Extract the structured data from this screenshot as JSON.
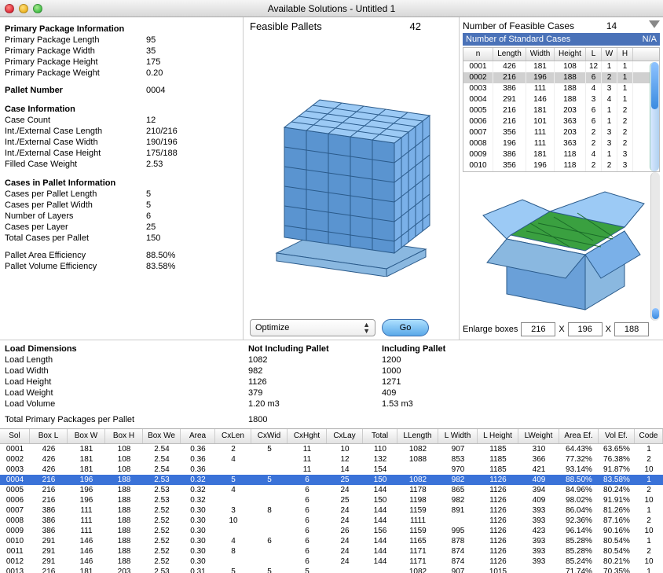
{
  "window": {
    "title": "Available Solutions - Untitled 1"
  },
  "left": {
    "sec1": "Primary Package Information",
    "ppl_l": "Primary Package Length",
    "ppl_v": "95",
    "ppw_l": "Primary Package Width",
    "ppw_v": "35",
    "pph_l": "Primary Package Height",
    "pph_v": "175",
    "ppwe_l": "Primary Package Weight",
    "ppwe_v": "0.20",
    "pn_l": "Pallet Number",
    "pn_v": "0004",
    "sec2": "Case Information",
    "cc_l": "Case Count",
    "cc_v": "12",
    "icl_l": "Int./External Case Length",
    "icl_v": "210/216",
    "icw_l": "Int./External Case Width",
    "icw_v": "190/196",
    "ich_l": "Int./External Case Height",
    "ich_v": "175/188",
    "fcw_l": "Filled Case Weight",
    "fcw_v": "2.53",
    "sec3": "Cases in Pallet Information",
    "cpl_l": "Cases per Pallet Length",
    "cpl_v": "5",
    "cpw_l": "Cases per Pallet Width",
    "cpw_v": "5",
    "nl_l": "Number of Layers",
    "nl_v": "6",
    "cply_l": "Cases per Layer",
    "cply_v": "25",
    "tcp_l": "Total Cases per Pallet",
    "tcp_v": "150",
    "pae_l": "Pallet Area Efficiency",
    "pae_v": "88.50%",
    "pve_l": "Pallet Volume Efficiency",
    "pve_v": "83.58%"
  },
  "center": {
    "fp_label": "Feasible Pallets",
    "fp_val": "42",
    "optimize": "Optimize",
    "go": "Go"
  },
  "right": {
    "nf_label": "Number of Feasible Cases",
    "nf_val": "14",
    "ns_label": "Number of Standard Cases",
    "ns_val": "N/A",
    "hdr": {
      "n": "n",
      "len": "Length",
      "wid": "Width",
      "hgt": "Height",
      "L": "L",
      "W": "W",
      "H": "H"
    },
    "rows": [
      {
        "n": "0001",
        "len": "426",
        "wid": "181",
        "hgt": "108",
        "L": "12",
        "W": "1",
        "H": "1"
      },
      {
        "n": "0002",
        "len": "216",
        "wid": "196",
        "hgt": "188",
        "L": "6",
        "W": "2",
        "H": "1",
        "sel": true
      },
      {
        "n": "0003",
        "len": "386",
        "wid": "111",
        "hgt": "188",
        "L": "4",
        "W": "3",
        "H": "1"
      },
      {
        "n": "0004",
        "len": "291",
        "wid": "146",
        "hgt": "188",
        "L": "3",
        "W": "4",
        "H": "1"
      },
      {
        "n": "0005",
        "len": "216",
        "wid": "181",
        "hgt": "203",
        "L": "6",
        "W": "1",
        "H": "2"
      },
      {
        "n": "0006",
        "len": "216",
        "wid": "101",
        "hgt": "363",
        "L": "6",
        "W": "1",
        "H": "2"
      },
      {
        "n": "0007",
        "len": "356",
        "wid": "111",
        "hgt": "203",
        "L": "2",
        "W": "3",
        "H": "2"
      },
      {
        "n": "0008",
        "len": "196",
        "wid": "111",
        "hgt": "363",
        "L": "2",
        "W": "3",
        "H": "2"
      },
      {
        "n": "0009",
        "len": "386",
        "wid": "181",
        "hgt": "118",
        "L": "4",
        "W": "1",
        "H": "3"
      },
      {
        "n": "0010",
        "len": "356",
        "wid": "196",
        "hgt": "118",
        "L": "2",
        "W": "2",
        "H": "3"
      }
    ],
    "enlarge_l": "Enlarge boxes",
    "e1": "216",
    "eX1": "X",
    "e2": "196",
    "eX2": "X",
    "e3": "188"
  },
  "load": {
    "hd": "Load Dimensions",
    "nip": "Not Including Pallet",
    "ip": "Including Pallet",
    "rows": [
      {
        "l": "Load Length",
        "a": "1082",
        "b": "1200"
      },
      {
        "l": "Load Width",
        "a": "982",
        "b": "1000"
      },
      {
        "l": "Load Height",
        "a": "1126",
        "b": "1271"
      },
      {
        "l": "Load Weight",
        "a": "379",
        "b": "409"
      },
      {
        "l": "Load Volume",
        "a": "1.20 m3",
        "b": "1.53 m3"
      }
    ],
    "tpp_l": "Total Primary Packages per Pallet",
    "tpp_v": "1800"
  },
  "table": {
    "hdr": {
      "sol": "Sol",
      "bl": "Box L",
      "bw": "Box W",
      "bh": "Box H",
      "bwe": "Box We",
      "ar": "Area",
      "cl": "CxLen",
      "cw": "CxWid",
      "ch": "CxHght",
      "cx": "CxLay",
      "tot": "Total",
      "ll": "LLength",
      "lw": "L Width",
      "lh": "L Height",
      "lwe": "LWeight",
      "ae": "Area Ef.",
      "ve": "Vol Ef.",
      "cd": "Code"
    },
    "rows": [
      {
        "sol": "0001",
        "bl": "426",
        "bw": "181",
        "bh": "108",
        "bwe": "2.54",
        "ar": "0.36",
        "cl": "2",
        "cw": "5",
        "ch": "11",
        "cx": "10",
        "tot": "110",
        "ll": "1082",
        "lw": "907",
        "lh": "1185",
        "lwe": "310",
        "ae": "64.43%",
        "ve": "63.65%",
        "cd": "1"
      },
      {
        "sol": "0002",
        "bl": "426",
        "bw": "181",
        "bh": "108",
        "bwe": "2.54",
        "ar": "0.36",
        "cl": "4",
        "cw": "",
        "ch": "11",
        "cx": "12",
        "tot": "132",
        "ll": "1088",
        "lw": "853",
        "lh": "1185",
        "lwe": "366",
        "ae": "77.32%",
        "ve": "76.38%",
        "cd": "2"
      },
      {
        "sol": "0003",
        "bl": "426",
        "bw": "181",
        "bh": "108",
        "bwe": "2.54",
        "ar": "0.36",
        "cl": "",
        "cw": "",
        "ch": "11",
        "cx": "14",
        "tot": "154",
        "ll": "",
        "lw": "970",
        "lh": "1185",
        "lwe": "421",
        "ae": "93.14%",
        "ve": "91.87%",
        "cd": "10"
      },
      {
        "sol": "0004",
        "bl": "216",
        "bw": "196",
        "bh": "188",
        "bwe": "2.53",
        "ar": "0.32",
        "cl": "5",
        "cw": "5",
        "ch": "6",
        "cx": "25",
        "tot": "150",
        "ll": "1082",
        "lw": "982",
        "lh": "1126",
        "lwe": "409",
        "ae": "88.50%",
        "ve": "83.58%",
        "cd": "1",
        "sel": true
      },
      {
        "sol": "0005",
        "bl": "216",
        "bw": "196",
        "bh": "188",
        "bwe": "2.53",
        "ar": "0.32",
        "cl": "4",
        "cw": "",
        "ch": "6",
        "cx": "24",
        "tot": "144",
        "ll": "1178",
        "lw": "865",
        "lh": "1126",
        "lwe": "394",
        "ae": "84.96%",
        "ve": "80.24%",
        "cd": "2"
      },
      {
        "sol": "0006",
        "bl": "216",
        "bw": "196",
        "bh": "188",
        "bwe": "2.53",
        "ar": "0.32",
        "cl": "",
        "cw": "",
        "ch": "6",
        "cx": "25",
        "tot": "150",
        "ll": "1198",
        "lw": "982",
        "lh": "1126",
        "lwe": "409",
        "ae": "98.02%",
        "ve": "91.91%",
        "cd": "10"
      },
      {
        "sol": "0007",
        "bl": "386",
        "bw": "111",
        "bh": "188",
        "bwe": "2.52",
        "ar": "0.30",
        "cl": "3",
        "cw": "8",
        "ch": "6",
        "cx": "24",
        "tot": "144",
        "ll": "1159",
        "lw": "891",
        "lh": "1126",
        "lwe": "393",
        "ae": "86.04%",
        "ve": "81.26%",
        "cd": "1"
      },
      {
        "sol": "0008",
        "bl": "386",
        "bw": "111",
        "bh": "188",
        "bwe": "2.52",
        "ar": "0.30",
        "cl": "10",
        "cw": "",
        "ch": "6",
        "cx": "24",
        "tot": "144",
        "ll": "1111",
        "lw": "",
        "lh": "1126",
        "lwe": "393",
        "ae": "92.36%",
        "ve": "87.16%",
        "cd": "2"
      },
      {
        "sol": "0009",
        "bl": "386",
        "bw": "111",
        "bh": "188",
        "bwe": "2.52",
        "ar": "0.30",
        "cl": "",
        "cw": "",
        "ch": "6",
        "cx": "26",
        "tot": "156",
        "ll": "1159",
        "lw": "995",
        "lh": "1126",
        "lwe": "423",
        "ae": "96.14%",
        "ve": "90.16%",
        "cd": "10"
      },
      {
        "sol": "0010",
        "bl": "291",
        "bw": "146",
        "bh": "188",
        "bwe": "2.52",
        "ar": "0.30",
        "cl": "4",
        "cw": "6",
        "ch": "6",
        "cx": "24",
        "tot": "144",
        "ll": "1165",
        "lw": "878",
        "lh": "1126",
        "lwe": "393",
        "ae": "85.28%",
        "ve": "80.54%",
        "cd": "1"
      },
      {
        "sol": "0011",
        "bl": "291",
        "bw": "146",
        "bh": "188",
        "bwe": "2.52",
        "ar": "0.30",
        "cl": "8",
        "cw": "",
        "ch": "6",
        "cx": "24",
        "tot": "144",
        "ll": "1171",
        "lw": "874",
        "lh": "1126",
        "lwe": "393",
        "ae": "85.28%",
        "ve": "80.54%",
        "cd": "2"
      },
      {
        "sol": "0012",
        "bl": "291",
        "bw": "146",
        "bh": "188",
        "bwe": "2.52",
        "ar": "0.30",
        "cl": "",
        "cw": "",
        "ch": "6",
        "cx": "24",
        "tot": "144",
        "ll": "1171",
        "lw": "874",
        "lh": "1126",
        "lwe": "393",
        "ae": "85.24%",
        "ve": "80.21%",
        "cd": "10"
      },
      {
        "sol": "0013",
        "bl": "216",
        "bw": "181",
        "bh": "203",
        "bwe": "2.53",
        "ar": "0.31",
        "cl": "5",
        "cw": "5",
        "ch": "5",
        "cx": "",
        "tot": "",
        "ll": "1082",
        "lw": "907",
        "lh": "1015",
        "lwe": "",
        "ae": "71.74%",
        "ve": "70.35%",
        "cd": "1"
      }
    ]
  }
}
